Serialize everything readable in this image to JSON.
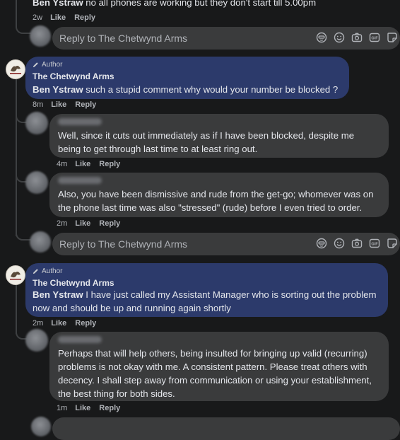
{
  "top_comment": {
    "mention": "Ben Ystraw",
    "text": "no all phones are working but they don't start till 5.00pm",
    "time": "2w",
    "like": "Like",
    "reply": "Reply"
  },
  "reply_box_1": {
    "placeholder": "Reply to The Chetwynd Arms"
  },
  "author_comment_1": {
    "badge": "Author",
    "name": "The Chetwynd Arms",
    "mention": "Ben Ystraw",
    "text": "such a stupid comment why would your number be blocked ?",
    "time": "8m",
    "like": "Like",
    "reply": "Reply"
  },
  "user_reply_1": {
    "lines": [
      "Well, since it cuts out immediately as if I have been blocked, despite me",
      "being to get through last time to at least ring out."
    ],
    "time": "4m",
    "like": "Like",
    "reply": "Reply"
  },
  "user_reply_2": {
    "lines": [
      "Also, you have been dismissive and rude from the get-go; whomever was on",
      "the phone last time was also \"stressed\" (rude) before I even tried to order."
    ],
    "time": "2m",
    "like": "Like",
    "reply": "Reply"
  },
  "reply_box_2": {
    "placeholder": "Reply to The Chetwynd Arms"
  },
  "author_comment_2": {
    "badge": "Author",
    "name": "The Chetwynd Arms",
    "mention": "Ben Ystraw",
    "lines": [
      "I have just called my Assistant Manager who is sorting out the problem",
      "now and should be up and running again shortly"
    ],
    "time": "2m",
    "like": "Like",
    "reply": "Reply"
  },
  "user_reply_3": {
    "lines": [
      "Perhaps that will help others, being insulted for bringing up valid (recurring)",
      "problems is not okay with me. A consistent pattern. Please treat others with",
      "decency. I shall step away from communication or using your establishment,",
      "the best thing for both sides."
    ],
    "time": "1m",
    "like": "Like",
    "reply": "Reply"
  },
  "toolbar_icons": [
    "avatar-sticker-icon",
    "emoji-icon",
    "camera-icon",
    "gif-icon",
    "sticker-icon"
  ]
}
